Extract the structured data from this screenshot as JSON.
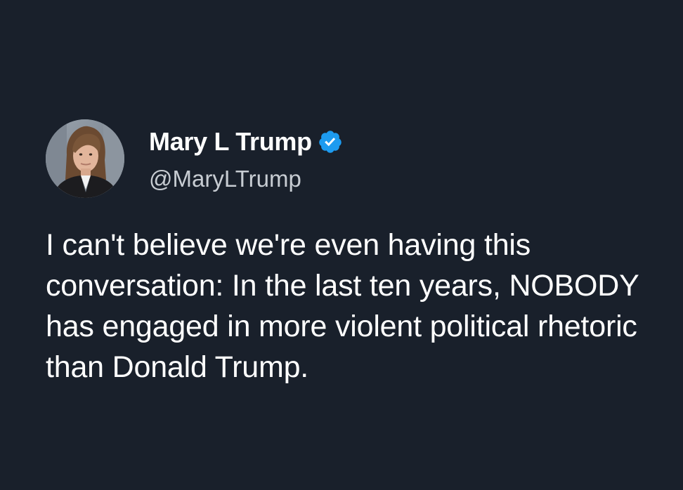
{
  "tweet": {
    "author": {
      "display_name": "Mary L Trump",
      "handle": "@MaryLTrump",
      "verified": true,
      "avatar_icon": "profile-photo"
    },
    "text": "I can't believe we're even having this conversation: In the last ten years, NOBODY has engaged in more violent political rhetoric than Donald Trump."
  },
  "colors": {
    "background": "#19202b",
    "name": "#ffffff",
    "handle": "#c7ccd2",
    "verified_badge": "#1d9bf0"
  }
}
